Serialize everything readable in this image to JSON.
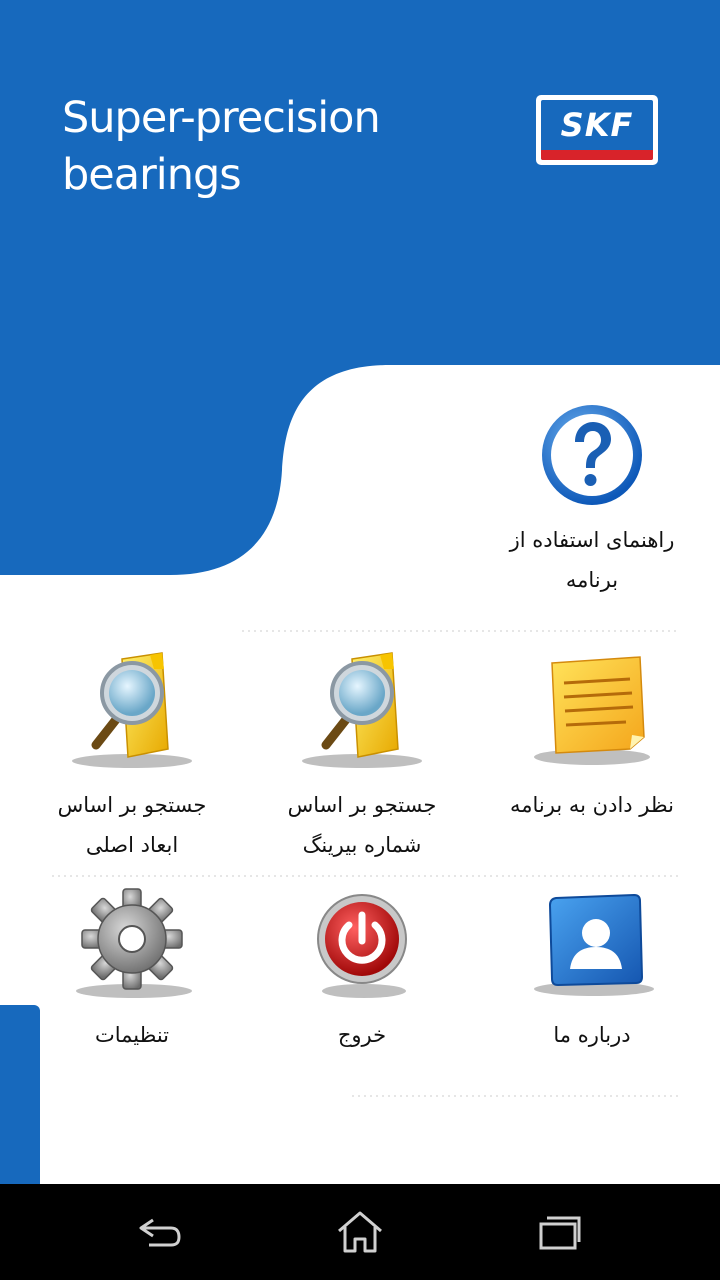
{
  "header": {
    "title_line1": "Super-precision",
    "title_line2": "bearings",
    "logo_text": "SKF"
  },
  "colors": {
    "brand_blue": "#1769bd",
    "skf_red": "#d8232a",
    "navbar": "#000000"
  },
  "menu": {
    "help": {
      "label": "راهنمای استفاده از\nبرنامه",
      "icon": "help-icon"
    },
    "feedback": {
      "label": "نظر دادن به برنامه",
      "icon": "note-icon"
    },
    "search_number": {
      "label": "جستجو بر اساس\nشماره بیرینگ",
      "icon": "search-folder-icon"
    },
    "search_dims": {
      "label": "جستجو بر اساس\nابعاد اصلی",
      "icon": "search-folder-icon"
    },
    "about": {
      "label": "درباره ما",
      "icon": "contact-icon"
    },
    "exit": {
      "label": "خروج",
      "icon": "power-icon"
    },
    "settings": {
      "label": "تنظیمات",
      "icon": "gear-icon"
    }
  },
  "navbar": {
    "back": "back-icon",
    "home": "home-icon",
    "recents": "recents-icon"
  }
}
